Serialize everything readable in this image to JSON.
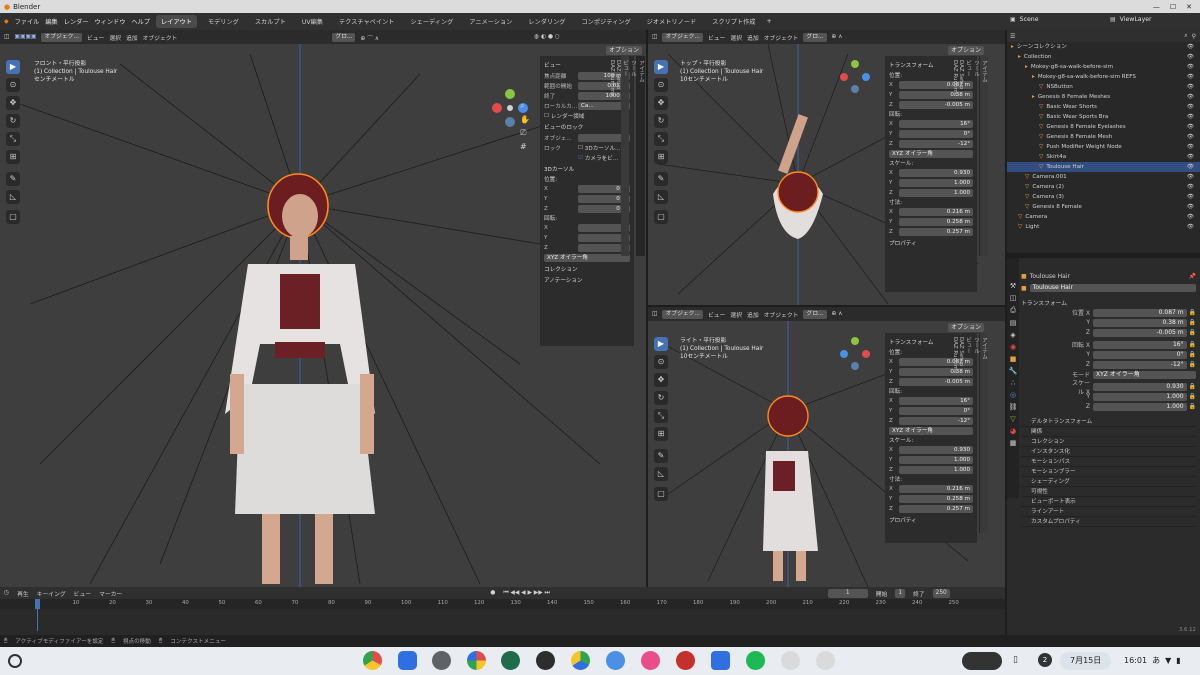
{
  "titlebar": {
    "title": "Blender",
    "controls": [
      "—",
      "☐",
      "✕"
    ]
  },
  "menubar": {
    "menus": [
      "ファイル",
      "編集",
      "レンダー",
      "ウィンドウ",
      "ヘルプ"
    ],
    "workspaces": [
      "レイアウト",
      "モデリング",
      "スカルプト",
      "UV編集",
      "テクスチャペイント",
      "シェーディング",
      "アニメーション",
      "レンダリング",
      "コンポジティング",
      "ジオメトリノード",
      "スクリプト作成"
    ],
    "active_workspace": "レイアウト",
    "add": "+",
    "scene": "Scene",
    "viewlayer": "ViewLayer"
  },
  "viewport_main": {
    "header": [
      "オブジェク...",
      "ビュー",
      "選択",
      "追加",
      "オブジェクト"
    ],
    "transform": "グロ...",
    "options": "オプション",
    "view_name": "フロント・平行投影",
    "collection": "(1) Collection | Toulouse Hair",
    "scale": "センチメートル"
  },
  "npanel_main": {
    "view_title": "ビュー",
    "focal_label": "焦点距離",
    "focal_value": "100 mm",
    "clip_start_label": "範囲の開始",
    "clip_start_value": "0.01 m",
    "clip_end_label": "終了",
    "clip_end_value": "1000 m",
    "local_cam": "ローカルカ...",
    "local_cam_value": "Ca...",
    "render_region": "レンダー領域",
    "view_lock": "ビューのロック",
    "lock_obj": "オブジェ...",
    "lock": "ロック",
    "lock_3d": "3Dカーソル...",
    "lock_cam": "カメラをビ...",
    "cursor_title": "3Dカーソル",
    "pos": "位置:",
    "rot": "回転:",
    "cursor_pos": [
      [
        "X",
        "0 m"
      ],
      [
        "Y",
        "0 m"
      ],
      [
        "Z",
        "0 m"
      ]
    ],
    "cursor_rot": [
      [
        "X",
        "0°"
      ],
      [
        "Y",
        "0°"
      ],
      [
        "Z",
        "0°"
      ]
    ],
    "rot_mode": "XYZ オイラー角",
    "collection": "コレクション",
    "annotation": "アノテーション",
    "tabs": [
      "アイテム",
      "ツール",
      "ビュー",
      "DAZ Setup",
      "DAZ Runtime"
    ]
  },
  "viewport_top": {
    "header": [
      "オブジェク...",
      "ビュー",
      "選択",
      "追加",
      "オブジェクト"
    ],
    "transform": "グロ...",
    "options": "オプション",
    "view_name": "トップ・平行投影",
    "collection": "(1) Collection | Toulouse Hair",
    "scale": "10センチメートル"
  },
  "viewport_right": {
    "header": [
      "オブジェク...",
      "ビュー",
      "選択",
      "追加",
      "オブジェクト"
    ],
    "transform": "グロ...",
    "options": "オプション",
    "view_name": "ライト・平行投影",
    "collection": "(1) Collection | Toulouse Hair",
    "scale": "10センチメートル"
  },
  "npanel_transform": {
    "title": "トランスフォーム",
    "pos": "位置:",
    "rot": "回転:",
    "scale": "スケール:",
    "dims": "寸法:",
    "location": [
      [
        "X",
        "0.087 m"
      ],
      [
        "Y",
        "0.38 m"
      ],
      [
        "Z",
        "-0.005 m"
      ]
    ],
    "rotation": [
      [
        "X",
        "16°"
      ],
      [
        "Y",
        "0°"
      ],
      [
        "Z",
        "-12°"
      ]
    ],
    "rot_mode": "XYZ オイラー角",
    "scale_vals": [
      [
        "X",
        "0.930"
      ],
      [
        "Y",
        "1.000"
      ],
      [
        "Z",
        "1.000"
      ]
    ],
    "dimensions": [
      [
        "X",
        "0.216 m"
      ],
      [
        "Y",
        "0.258 m"
      ],
      [
        "Z",
        "0.257 m"
      ]
    ],
    "properties": "プロパティ",
    "tabs": [
      "アイテム",
      "ツール",
      "ビュー",
      "DAZ Setup",
      "DAZ Runtime"
    ]
  },
  "outliner": {
    "rows": [
      {
        "label": "シーンコレクション",
        "indent": 0,
        "sel": false
      },
      {
        "label": "Collection",
        "indent": 1,
        "sel": false
      },
      {
        "label": "Mokey-g8-sa-walk-before-sim",
        "indent": 2,
        "sel": false
      },
      {
        "label": "Mokey-g8-sa-walk-before-sim REFS",
        "indent": 3,
        "sel": false
      },
      {
        "label": "NSButton",
        "indent": 4,
        "sel": false
      },
      {
        "label": "Genesis 8 Female Meshes",
        "indent": 3,
        "sel": false
      },
      {
        "label": "Basic Wear Shorts",
        "indent": 4,
        "sel": false
      },
      {
        "label": "Basic Wear Sports Bra",
        "indent": 4,
        "sel": false
      },
      {
        "label": "Genesis 8 Female Eyelashes",
        "indent": 4,
        "sel": false
      },
      {
        "label": "Genesis 8 Female Mesh",
        "indent": 4,
        "sel": false
      },
      {
        "label": "Push Modifier Weight Node",
        "indent": 4,
        "sel": false
      },
      {
        "label": "Skirt4a",
        "indent": 4,
        "sel": false
      },
      {
        "label": "Toulouse Hair",
        "indent": 4,
        "sel": true
      },
      {
        "label": "Camera.001",
        "indent": 2,
        "sel": false
      },
      {
        "label": "Camera (2)",
        "indent": 2,
        "sel": false
      },
      {
        "label": "Camera (3)",
        "indent": 2,
        "sel": false
      },
      {
        "label": "Genesis 8 Female",
        "indent": 2,
        "sel": false
      },
      {
        "label": "Camera",
        "indent": 1,
        "sel": false
      },
      {
        "label": "Light",
        "indent": 1,
        "sel": false
      }
    ]
  },
  "properties": {
    "object": "Toulouse Hair",
    "name_field": "Toulouse Hair",
    "transform": "トランスフォーム",
    "loc_label": "位置 X",
    "rot_label": "回転 X",
    "mode_label": "モード",
    "mode_value": "XYZ オイラー角",
    "scale_label": "スケール X",
    "loc": [
      "0.087 m",
      "0.38 m",
      "-0.005 m"
    ],
    "rot": [
      "16°",
      "0°",
      "-12°"
    ],
    "scale": [
      "0.930",
      "1.000",
      "1.000"
    ],
    "sections": [
      "デルタトランスフォーム",
      "関係",
      "コレクション",
      "インスタンス化",
      "モーションパス",
      "モーションブラー",
      "シェーディング",
      "可視性",
      "ビューポート表示",
      "ラインアート",
      "カスタムプロパティ"
    ]
  },
  "timeline": {
    "menus": [
      "再生",
      "キーイング",
      "ビュー",
      "マーカー"
    ],
    "current_frame": "1",
    "start_label": "開始",
    "start": "1",
    "end_label": "終了",
    "end": "250",
    "ticks": [
      "1",
      "10",
      "20",
      "30",
      "40",
      "50",
      "60",
      "70",
      "80",
      "90",
      "100",
      "110",
      "120",
      "130",
      "140",
      "150",
      "160",
      "170",
      "180",
      "190",
      "200",
      "210",
      "220",
      "230",
      "240",
      "250"
    ]
  },
  "statusbar": {
    "left": "アクティブモディファイアーを設定",
    "mid": "視点の移動",
    "ctx": "コンテクストメニュー",
    "version": "3.6.12"
  },
  "taskbar": {
    "date": "7月15日",
    "time": "16:01",
    "ime": "あ",
    "notif": "2",
    "apps": [
      "chrome",
      "files",
      "settings",
      "photos",
      "terminal-dev",
      "terminal",
      "play-store",
      "feather",
      "cat",
      "vscode-like",
      "docs",
      "spotify",
      "penguin",
      "penguin2"
    ],
    "colors": {
      "accent": "#4772b3",
      "selected": "#334d80",
      "hair_outline": "#ff8a1c"
    }
  }
}
